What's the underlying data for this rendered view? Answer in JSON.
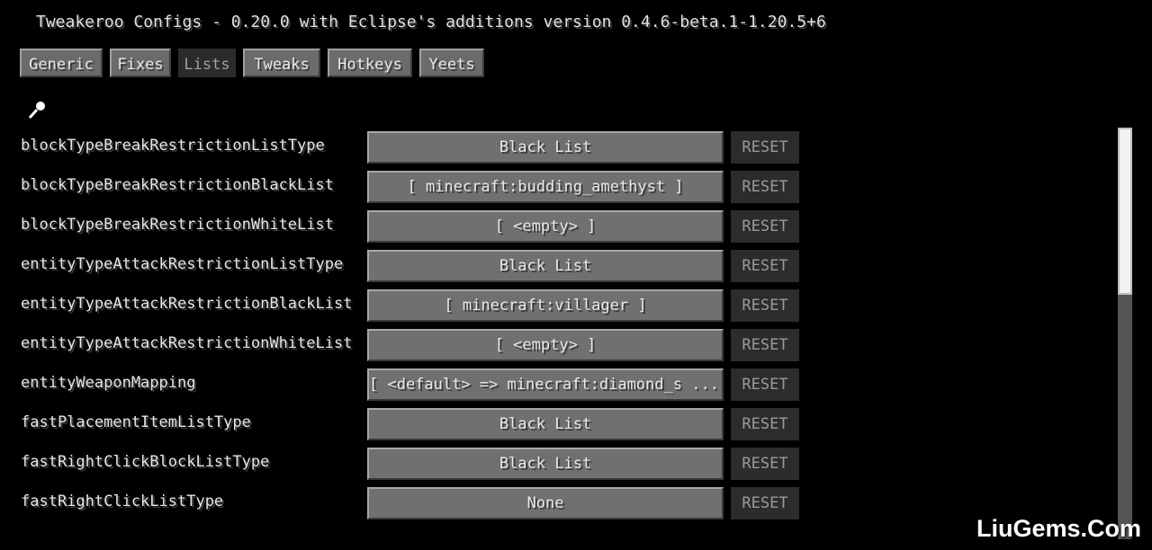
{
  "title": "Tweakeroo Configs - 0.20.0 with Eclipse's additions version 0.4.6-beta.1-1.20.5+6",
  "tabs": [
    {
      "label": "Generic",
      "active": false
    },
    {
      "label": "Fixes",
      "active": false
    },
    {
      "label": "Lists",
      "active": true
    },
    {
      "label": "Tweaks",
      "active": false
    },
    {
      "label": "Hotkeys",
      "active": false
    },
    {
      "label": "Yeets",
      "active": false
    }
  ],
  "search": {
    "icon": "search-icon"
  },
  "reset_label": "RESET",
  "rows": [
    {
      "label": "blockTypeBreakRestrictionListType",
      "value": "Black List"
    },
    {
      "label": "blockTypeBreakRestrictionBlackList",
      "value": "[ minecraft:budding_amethyst ]"
    },
    {
      "label": "blockTypeBreakRestrictionWhiteList",
      "value": "[ <empty> ]"
    },
    {
      "label": "entityTypeAttackRestrictionListType",
      "value": "Black List"
    },
    {
      "label": "entityTypeAttackRestrictionBlackList",
      "value": "[ minecraft:villager ]"
    },
    {
      "label": "entityTypeAttackRestrictionWhiteList",
      "value": "[ <empty> ]"
    },
    {
      "label": "entityWeaponMapping",
      "value": "[ <default> => minecraft:diamond_s ... ]"
    },
    {
      "label": "fastPlacementItemListType",
      "value": "Black List"
    },
    {
      "label": "fastRightClickBlockListType",
      "value": "Black List"
    },
    {
      "label": "fastRightClickListType",
      "value": "None"
    }
  ],
  "watermark": "LiuGems.Com"
}
